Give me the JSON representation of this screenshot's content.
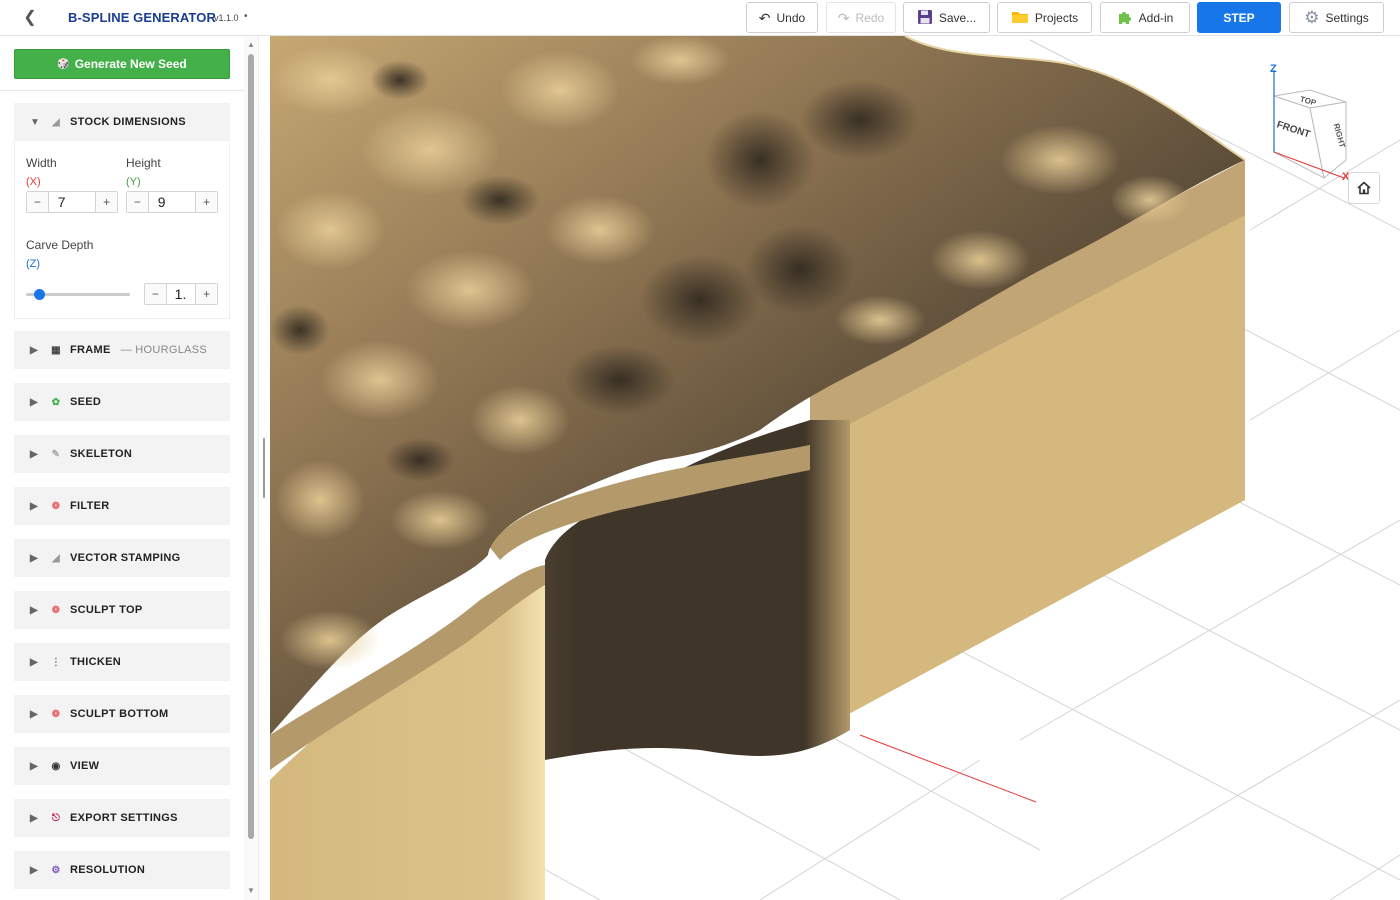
{
  "header": {
    "title": "B-SPLINE GENERATOR",
    "version": "v1.1.0",
    "dirty_marker": "•",
    "back_icon": "chevron-left-icon",
    "buttons": {
      "undo": "Undo",
      "redo": "Redo",
      "save": "Save...",
      "projects": "Projects",
      "addin": "Add-in",
      "step": "STEP",
      "settings": "Settings"
    }
  },
  "sidebar": {
    "generate_label": "Generate New Seed",
    "stock": {
      "title": "STOCK DIMENSIONS",
      "width_label": "Width",
      "width_axis": "(X)",
      "width_value": "7",
      "height_label": "Height",
      "height_axis": "(Y)",
      "height_value": "9",
      "depth_label": "Carve Depth",
      "depth_axis": "(Z)",
      "depth_value": "1.",
      "depth_slider_level": 0.12
    },
    "panels": [
      {
        "title": "FRAME",
        "subtitle": "— HOURGLASS"
      },
      {
        "title": "SEED"
      },
      {
        "title": "SKELETON"
      },
      {
        "title": "FILTER"
      },
      {
        "title": "VECTOR STAMPING"
      },
      {
        "title": "SCULPT TOP"
      },
      {
        "title": "THICKEN"
      },
      {
        "title": "SCULPT BOTTOM"
      },
      {
        "title": "VIEW"
      },
      {
        "title": "EXPORT SETTINGS"
      },
      {
        "title": "RESOLUTION"
      }
    ]
  },
  "viewcube": {
    "top": "TOP",
    "front": "FRONT",
    "right": "RIGHT",
    "axis_z": "Z",
    "axis_x": "X"
  },
  "colors": {
    "accent": "#1877e8",
    "generate": "#44b04a",
    "title": "#1a3d8f",
    "axis_x": "#e53935",
    "axis_y": "#43a047",
    "axis_z": "#1e6fd9",
    "model_light": "#d4b87e",
    "model_dark": "#463c2e"
  }
}
